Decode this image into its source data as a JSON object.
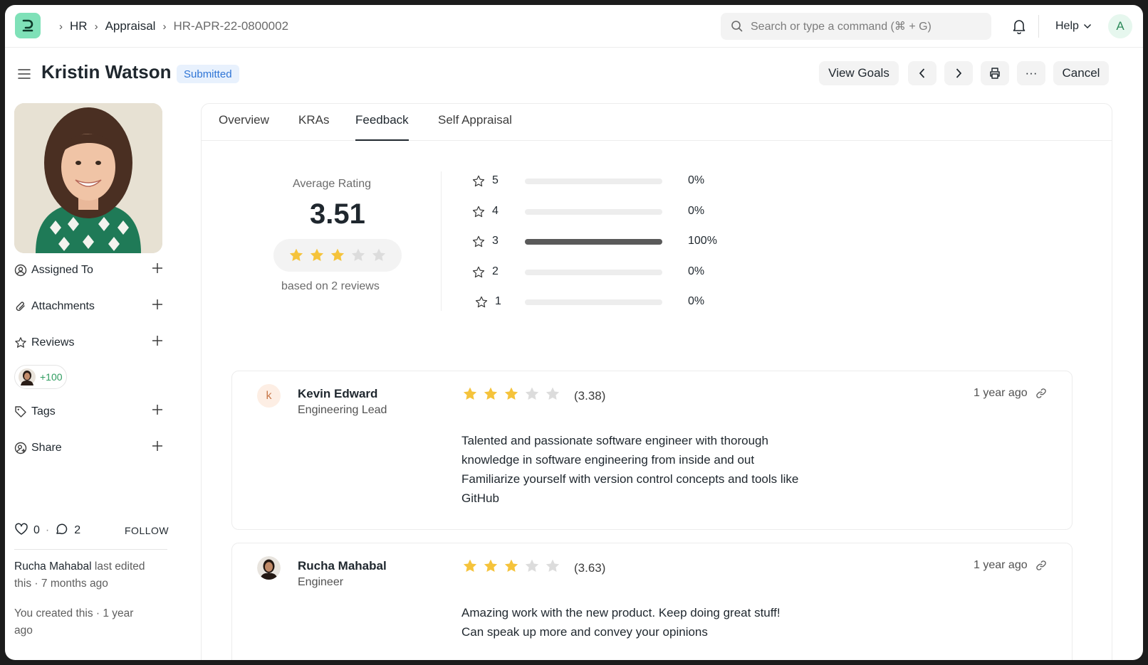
{
  "breadcrumbs": [
    "HR",
    "Appraisal",
    "HR-APR-22-0800002"
  ],
  "search": {
    "placeholder": "Search or type a command (⌘ + G)"
  },
  "nav": {
    "help_label": "Help",
    "user_initial": "A"
  },
  "header": {
    "title": "Kristin Watson",
    "status": "Submitted",
    "view_goals_label": "View Goals",
    "more_label": "···",
    "cancel_label": "Cancel"
  },
  "sidebar": {
    "assigned_to": "Assigned To",
    "attachments": "Attachments",
    "reviews": "Reviews",
    "reviewers_count": "+100",
    "tags": "Tags",
    "share": "Share",
    "likes": "0",
    "comments": "2",
    "follow": "FOLLOW",
    "activity": [
      {
        "user": "Rucha Mahabal",
        "line1_rest": " last edited",
        "line2": "this · 7 months ago"
      },
      {
        "line1": "You created this · 1 year",
        "line2": "ago"
      }
    ]
  },
  "tabs": [
    "Overview",
    "KRAs",
    "Feedback",
    "Self Appraisal"
  ],
  "active_tab": "Feedback",
  "rating": {
    "label": "Average Rating",
    "value": "3.51",
    "stars_filled": 3,
    "stars_total": 5,
    "based_on": "based on 2 reviews",
    "distribution": [
      {
        "stars": "5",
        "fraction": 0.0,
        "percent": "0%"
      },
      {
        "stars": "4",
        "fraction": 0.0,
        "percent": "0%"
      },
      {
        "stars": "3",
        "fraction": 1.0,
        "percent": "100%"
      },
      {
        "stars": "2",
        "fraction": 0.0,
        "percent": "0%"
      },
      {
        "stars": "1",
        "fraction": 0.0,
        "percent": "0%"
      }
    ]
  },
  "reviews": [
    {
      "initial": "k",
      "name": "Kevin Edward",
      "role": "Engineering Lead",
      "stars_filled": 3,
      "score": "(3.38)",
      "time": "1 year ago",
      "text": [
        "Talented and passionate software engineer with thorough",
        "knowledge in software engineering from inside and out",
        "Familiarize yourself with version control concepts and tools like",
        "GitHub"
      ]
    },
    {
      "initial": "",
      "name": "Rucha Mahabal",
      "role": "Engineer",
      "stars_filled": 3,
      "score": "(3.63)",
      "time": "1 year ago",
      "text": [
        "Amazing work with the new product. Keep doing great stuff!",
        "Can speak up more and convey your opinions"
      ]
    }
  ],
  "colors": {
    "star_filled": "#f5c33b",
    "star_empty": "#dcdcdc",
    "badge_bg": "#e8f1fd",
    "badge_text": "#2f75d6",
    "logo": "#7fe1b8"
  }
}
